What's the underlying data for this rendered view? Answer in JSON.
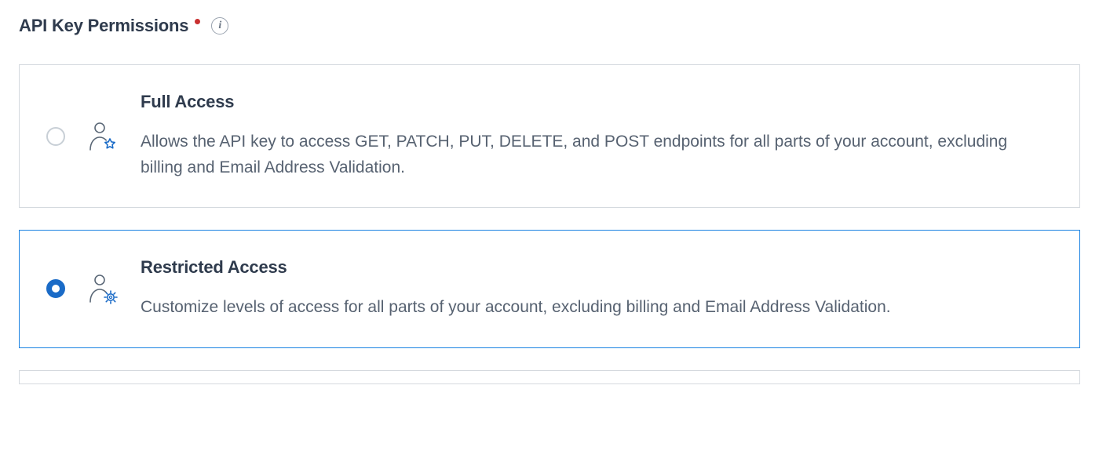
{
  "header": {
    "title": "API Key Permissions"
  },
  "options": [
    {
      "id": "full-access",
      "title": "Full Access",
      "description": "Allows the API key to access GET, PATCH, PUT, DELETE, and POST endpoints for all parts of your account, excluding billing and Email Address Validation.",
      "selected": false,
      "icon": "user-star"
    },
    {
      "id": "restricted-access",
      "title": "Restricted Access",
      "description": "Customize levels of access for all parts of your account, excluding billing and Email Address Validation.",
      "selected": true,
      "icon": "user-gear"
    }
  ],
  "colors": {
    "accent": "#1a82e2",
    "radio_checked": "#1a6bc7",
    "text_primary": "#2f3b4d",
    "text_secondary": "#576271",
    "border": "#d4d9de",
    "required": "#c93030"
  }
}
